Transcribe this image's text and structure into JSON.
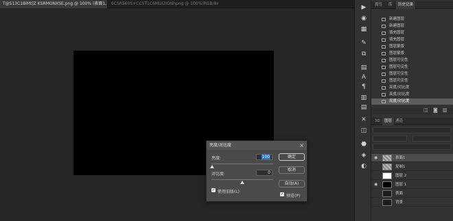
{
  "document_tabs": {
    "active": "T@S13C1BiMt]Z KSRMONXSE.png @ 100% (表面1, RGB/8#) *",
    "inactive": "6CSR560S+CCST1C6MUI2IONhpng @ 100%(RGB/8#)"
  },
  "dialog": {
    "title": "亮度/对比度",
    "close_glyph": "×",
    "brightness_label": "亮度:",
    "brightness_value": "100",
    "contrast_label": "对比度:",
    "contrast_value": "0",
    "ok_label": "确定",
    "cancel_label": "取消",
    "auto_label": "自动(A)",
    "legacy_label": "使用旧版(L)",
    "preview_label": "预览(P)",
    "legacy_checked": true,
    "preview_checked": true
  },
  "right_panel": {
    "history_tabs": [
      "属性",
      "库",
      "历史记录"
    ],
    "history_items": [
      "新建图层",
      "新建图层",
      "填充图层",
      "填充图层",
      "图层蒙版",
      "图层蒙版",
      "图层可见性",
      "图层可见性",
      "图层可见性",
      "图层可见性",
      "亮度/对比度",
      "亮度/对比度",
      "亮度/对比度"
    ],
    "history_selected_index": 12,
    "layers_tabs": [
      "3D",
      "图层",
      "通道"
    ],
    "layers": [
      {
        "name": "表面1",
        "visible": true,
        "thumb": "pattern",
        "selected": true
      },
      {
        "name": "复制1",
        "visible": false,
        "thumb": "pattern",
        "selected": false
      },
      {
        "name": "图层 2",
        "visible": false,
        "thumb": "white",
        "selected": false
      },
      {
        "name": "图层 1",
        "visible": true,
        "thumb": "black",
        "selected": false
      },
      {
        "name": "表面",
        "visible": false,
        "thumb": "dark",
        "selected": false
      },
      {
        "name": "背景",
        "visible": false,
        "thumb": "dark",
        "selected": false
      }
    ]
  },
  "colors": {
    "selection_blue": "#2a73d6",
    "canvas": "#000000"
  }
}
